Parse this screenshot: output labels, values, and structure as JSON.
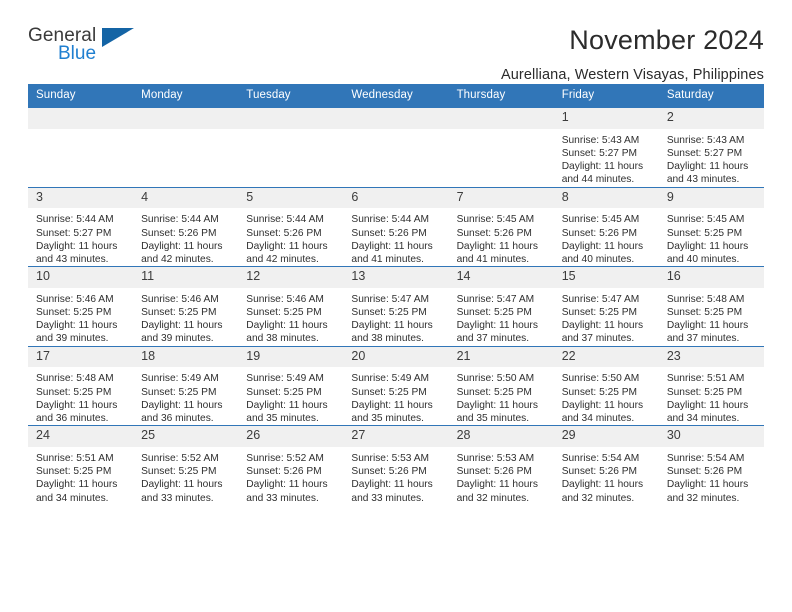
{
  "brand": {
    "name_top": "General",
    "name_bottom": "Blue",
    "accent_color": "#1f7fd0",
    "triangle_color": "#1464a5"
  },
  "header": {
    "title": "November 2024",
    "subtitle": "Aurelliana, Western Visayas, Philippines",
    "header_bg": "#3176b8",
    "daynum_bg": "#f0f0f0"
  },
  "weekdays": [
    "Sunday",
    "Monday",
    "Tuesday",
    "Wednesday",
    "Thursday",
    "Friday",
    "Saturday"
  ],
  "labels": {
    "sunrise_prefix": "Sunrise:",
    "sunset_prefix": "Sunset:",
    "daylight_prefix": "Daylight:"
  },
  "weeks": [
    [
      {
        "day": "",
        "empty": true
      },
      {
        "day": "",
        "empty": true
      },
      {
        "day": "",
        "empty": true
      },
      {
        "day": "",
        "empty": true
      },
      {
        "day": "",
        "empty": true
      },
      {
        "day": "1",
        "sunrise": "Sunrise: 5:43 AM",
        "sunset": "Sunset: 5:27 PM",
        "daylight_1": "Daylight: 11 hours",
        "daylight_2": "and 44 minutes."
      },
      {
        "day": "2",
        "sunrise": "Sunrise: 5:43 AM",
        "sunset": "Sunset: 5:27 PM",
        "daylight_1": "Daylight: 11 hours",
        "daylight_2": "and 43 minutes."
      }
    ],
    [
      {
        "day": "3",
        "sunrise": "Sunrise: 5:44 AM",
        "sunset": "Sunset: 5:27 PM",
        "daylight_1": "Daylight: 11 hours",
        "daylight_2": "and 43 minutes."
      },
      {
        "day": "4",
        "sunrise": "Sunrise: 5:44 AM",
        "sunset": "Sunset: 5:26 PM",
        "daylight_1": "Daylight: 11 hours",
        "daylight_2": "and 42 minutes."
      },
      {
        "day": "5",
        "sunrise": "Sunrise: 5:44 AM",
        "sunset": "Sunset: 5:26 PM",
        "daylight_1": "Daylight: 11 hours",
        "daylight_2": "and 42 minutes."
      },
      {
        "day": "6",
        "sunrise": "Sunrise: 5:44 AM",
        "sunset": "Sunset: 5:26 PM",
        "daylight_1": "Daylight: 11 hours",
        "daylight_2": "and 41 minutes."
      },
      {
        "day": "7",
        "sunrise": "Sunrise: 5:45 AM",
        "sunset": "Sunset: 5:26 PM",
        "daylight_1": "Daylight: 11 hours",
        "daylight_2": "and 41 minutes."
      },
      {
        "day": "8",
        "sunrise": "Sunrise: 5:45 AM",
        "sunset": "Sunset: 5:26 PM",
        "daylight_1": "Daylight: 11 hours",
        "daylight_2": "and 40 minutes."
      },
      {
        "day": "9",
        "sunrise": "Sunrise: 5:45 AM",
        "sunset": "Sunset: 5:25 PM",
        "daylight_1": "Daylight: 11 hours",
        "daylight_2": "and 40 minutes."
      }
    ],
    [
      {
        "day": "10",
        "sunrise": "Sunrise: 5:46 AM",
        "sunset": "Sunset: 5:25 PM",
        "daylight_1": "Daylight: 11 hours",
        "daylight_2": "and 39 minutes."
      },
      {
        "day": "11",
        "sunrise": "Sunrise: 5:46 AM",
        "sunset": "Sunset: 5:25 PM",
        "daylight_1": "Daylight: 11 hours",
        "daylight_2": "and 39 minutes."
      },
      {
        "day": "12",
        "sunrise": "Sunrise: 5:46 AM",
        "sunset": "Sunset: 5:25 PM",
        "daylight_1": "Daylight: 11 hours",
        "daylight_2": "and 38 minutes."
      },
      {
        "day": "13",
        "sunrise": "Sunrise: 5:47 AM",
        "sunset": "Sunset: 5:25 PM",
        "daylight_1": "Daylight: 11 hours",
        "daylight_2": "and 38 minutes."
      },
      {
        "day": "14",
        "sunrise": "Sunrise: 5:47 AM",
        "sunset": "Sunset: 5:25 PM",
        "daylight_1": "Daylight: 11 hours",
        "daylight_2": "and 37 minutes."
      },
      {
        "day": "15",
        "sunrise": "Sunrise: 5:47 AM",
        "sunset": "Sunset: 5:25 PM",
        "daylight_1": "Daylight: 11 hours",
        "daylight_2": "and 37 minutes."
      },
      {
        "day": "16",
        "sunrise": "Sunrise: 5:48 AM",
        "sunset": "Sunset: 5:25 PM",
        "daylight_1": "Daylight: 11 hours",
        "daylight_2": "and 37 minutes."
      }
    ],
    [
      {
        "day": "17",
        "sunrise": "Sunrise: 5:48 AM",
        "sunset": "Sunset: 5:25 PM",
        "daylight_1": "Daylight: 11 hours",
        "daylight_2": "and 36 minutes."
      },
      {
        "day": "18",
        "sunrise": "Sunrise: 5:49 AM",
        "sunset": "Sunset: 5:25 PM",
        "daylight_1": "Daylight: 11 hours",
        "daylight_2": "and 36 minutes."
      },
      {
        "day": "19",
        "sunrise": "Sunrise: 5:49 AM",
        "sunset": "Sunset: 5:25 PM",
        "daylight_1": "Daylight: 11 hours",
        "daylight_2": "and 35 minutes."
      },
      {
        "day": "20",
        "sunrise": "Sunrise: 5:49 AM",
        "sunset": "Sunset: 5:25 PM",
        "daylight_1": "Daylight: 11 hours",
        "daylight_2": "and 35 minutes."
      },
      {
        "day": "21",
        "sunrise": "Sunrise: 5:50 AM",
        "sunset": "Sunset: 5:25 PM",
        "daylight_1": "Daylight: 11 hours",
        "daylight_2": "and 35 minutes."
      },
      {
        "day": "22",
        "sunrise": "Sunrise: 5:50 AM",
        "sunset": "Sunset: 5:25 PM",
        "daylight_1": "Daylight: 11 hours",
        "daylight_2": "and 34 minutes."
      },
      {
        "day": "23",
        "sunrise": "Sunrise: 5:51 AM",
        "sunset": "Sunset: 5:25 PM",
        "daylight_1": "Daylight: 11 hours",
        "daylight_2": "and 34 minutes."
      }
    ],
    [
      {
        "day": "24",
        "sunrise": "Sunrise: 5:51 AM",
        "sunset": "Sunset: 5:25 PM",
        "daylight_1": "Daylight: 11 hours",
        "daylight_2": "and 34 minutes."
      },
      {
        "day": "25",
        "sunrise": "Sunrise: 5:52 AM",
        "sunset": "Sunset: 5:25 PM",
        "daylight_1": "Daylight: 11 hours",
        "daylight_2": "and 33 minutes."
      },
      {
        "day": "26",
        "sunrise": "Sunrise: 5:52 AM",
        "sunset": "Sunset: 5:26 PM",
        "daylight_1": "Daylight: 11 hours",
        "daylight_2": "and 33 minutes."
      },
      {
        "day": "27",
        "sunrise": "Sunrise: 5:53 AM",
        "sunset": "Sunset: 5:26 PM",
        "daylight_1": "Daylight: 11 hours",
        "daylight_2": "and 33 minutes."
      },
      {
        "day": "28",
        "sunrise": "Sunrise: 5:53 AM",
        "sunset": "Sunset: 5:26 PM",
        "daylight_1": "Daylight: 11 hours",
        "daylight_2": "and 32 minutes."
      },
      {
        "day": "29",
        "sunrise": "Sunrise: 5:54 AM",
        "sunset": "Sunset: 5:26 PM",
        "daylight_1": "Daylight: 11 hours",
        "daylight_2": "and 32 minutes."
      },
      {
        "day": "30",
        "sunrise": "Sunrise: 5:54 AM",
        "sunset": "Sunset: 5:26 PM",
        "daylight_1": "Daylight: 11 hours",
        "daylight_2": "and 32 minutes."
      }
    ]
  ]
}
